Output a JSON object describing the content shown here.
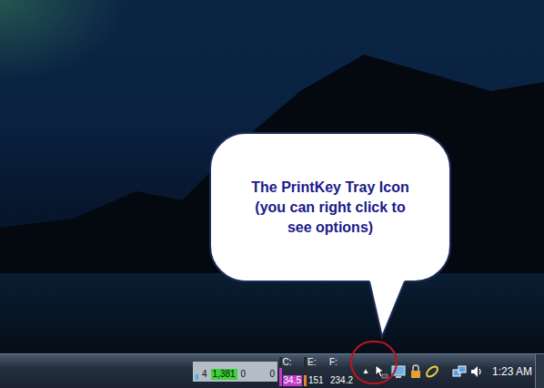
{
  "callout": {
    "lines": [
      "The PrintKey Tray Icon",
      "(you can right click to",
      "see options)"
    ]
  },
  "taskbar": {
    "meter": {
      "values": [
        {
          "text": "4",
          "kind": "plain"
        },
        {
          "text": "1,381",
          "kind": "box"
        },
        {
          "text": "0",
          "kind": "plain"
        },
        {
          "text": "0",
          "kind": "plain"
        }
      ]
    },
    "drives": [
      {
        "label": "C:",
        "reading": "34.5",
        "level": 0.6,
        "color": "#c03cc8"
      },
      {
        "label": "E:",
        "reading": "151",
        "level": 0.35,
        "color": "#e08a2a"
      },
      {
        "label": "F:",
        "reading": "234.2",
        "level": 0.4,
        "color": "#e08a2a"
      }
    ],
    "tray_overflow": "▲",
    "clock": "1:23 AM"
  }
}
